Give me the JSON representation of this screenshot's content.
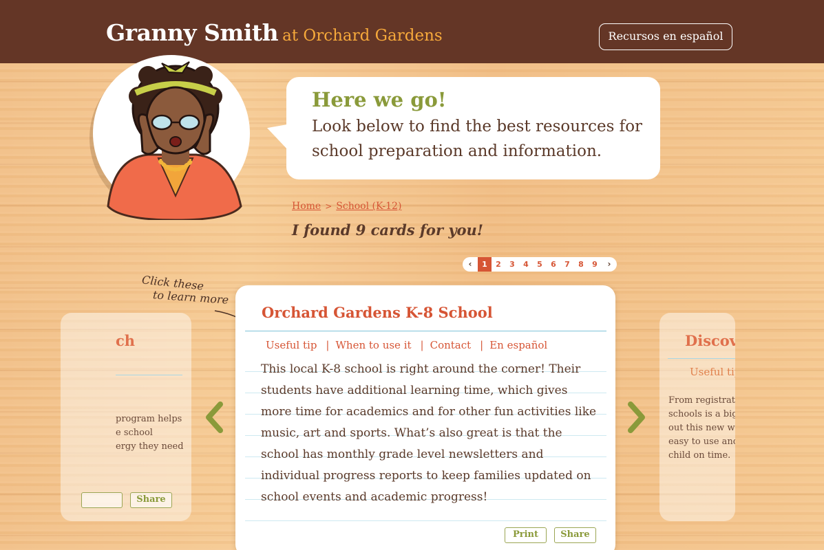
{
  "header": {
    "brand_name": "Granny Smith",
    "brand_sub": "at Orchard Gardens",
    "language_button": "Recursos en español"
  },
  "bubble": {
    "title": "Here we go!",
    "text": "Look below to find the best resources for school preparation and information."
  },
  "breadcrumb": {
    "items": [
      "Home",
      "School (K-12)"
    ],
    "separator": ">"
  },
  "results": {
    "found_text": "I found 9 cards for you!"
  },
  "pagination": {
    "prev_label": "‹",
    "next_label": "›",
    "pages": [
      "1",
      "2",
      "3",
      "4",
      "5",
      "6",
      "7",
      "8",
      "9"
    ],
    "current_page": "1"
  },
  "hint": {
    "line1": "Click these",
    "line2": "to learn more"
  },
  "main_card": {
    "title": "Orchard Gardens K-8 School",
    "tabs": [
      "Useful tip",
      "When to use it",
      "Contact",
      "En español"
    ],
    "tab_separator": "|",
    "body": "This local K-8 school is right around the corner! Their students have additional learning time, which gives more time for academics and for other fun activities like music, art and sports. What’s also great is that the school has monthly grade level newsletters and individual progress reports to keep families updated on school events and academic progress!",
    "print_label": "Print",
    "share_label": "Share"
  },
  "left_card": {
    "title_partial": "ch",
    "text_lines": [
      "program helps",
      "e school",
      "ergy they need"
    ],
    "share_label": "Share"
  },
  "right_card": {
    "title_partial": "Discov",
    "tab_partial": "Useful tip",
    "text_lines": [
      "From registrati",
      "schools is a big",
      "out this new we",
      "easy to use and",
      "child on time."
    ]
  },
  "colors": {
    "header_bg": "#643626",
    "accent_red": "#d65535",
    "accent_green": "#8a9a3a",
    "accent_orange": "#f6a93b",
    "text_brown": "#5b3a2a"
  },
  "icons": {
    "prev": "chevron-left-icon",
    "next": "chevron-right-icon"
  }
}
